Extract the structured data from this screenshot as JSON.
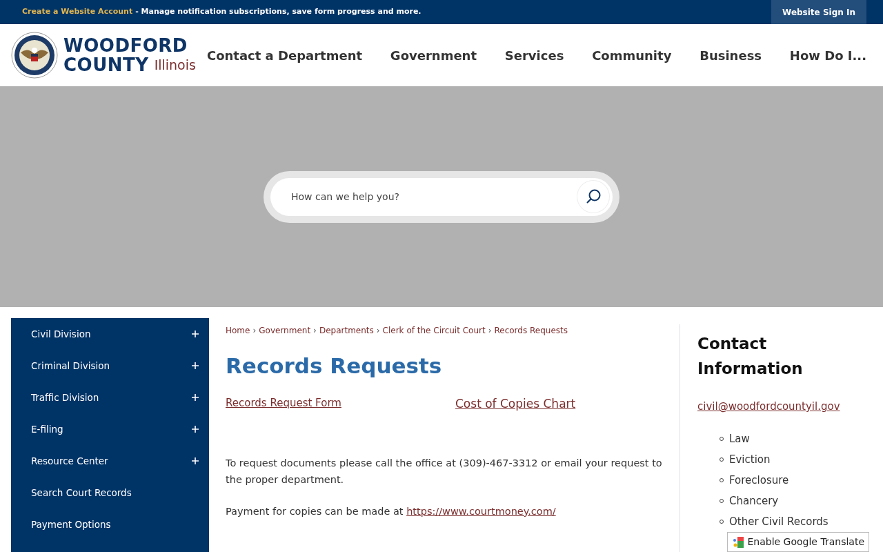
{
  "top_bar": {
    "account_link": "Create a Website Account",
    "message": "- Manage notification subscriptions, save form progress and more.",
    "sign_in": "Website Sign In"
  },
  "logo": {
    "line1": "WOODFORD",
    "line2": "COUNTY",
    "state": "Illinois"
  },
  "nav": [
    "Contact a Department",
    "Government",
    "Services",
    "Community",
    "Business",
    "How Do I..."
  ],
  "search": {
    "placeholder": "How can we help you?"
  },
  "sidebar": {
    "items": [
      {
        "label": "Civil Division",
        "expandable": true
      },
      {
        "label": "Criminal Division",
        "expandable": true
      },
      {
        "label": "Traffic Division",
        "expandable": true
      },
      {
        "label": "E-filing",
        "expandable": true
      },
      {
        "label": "Resource Center",
        "expandable": true
      },
      {
        "label": "Search Court Records",
        "expandable": false
      },
      {
        "label": "Payment Options",
        "expandable": false
      }
    ]
  },
  "breadcrumb": [
    "Home",
    "Government",
    "Departments",
    "Clerk of the Circuit Court",
    "Records Requests"
  ],
  "breadcrumb_separator": "›",
  "title": "Records Requests",
  "links": [
    "Records Request Form",
    "Cost of Copies Chart"
  ],
  "paragraphs": [
    {
      "text": "To request documents please call the office at (309)-467-3312 or email your request to the proper department."
    },
    {
      "text": "Payment for copies can be made at",
      "link": "https://www.courtmoney.com/"
    }
  ],
  "contact": {
    "title": "Contact Information",
    "email": "civil@woodfordcountyil.gov",
    "items": [
      "Law",
      "Eviction",
      "Foreclosure",
      "Chancery",
      "Other Civil Records"
    ]
  },
  "translate_button": "Enable Google Translate"
}
